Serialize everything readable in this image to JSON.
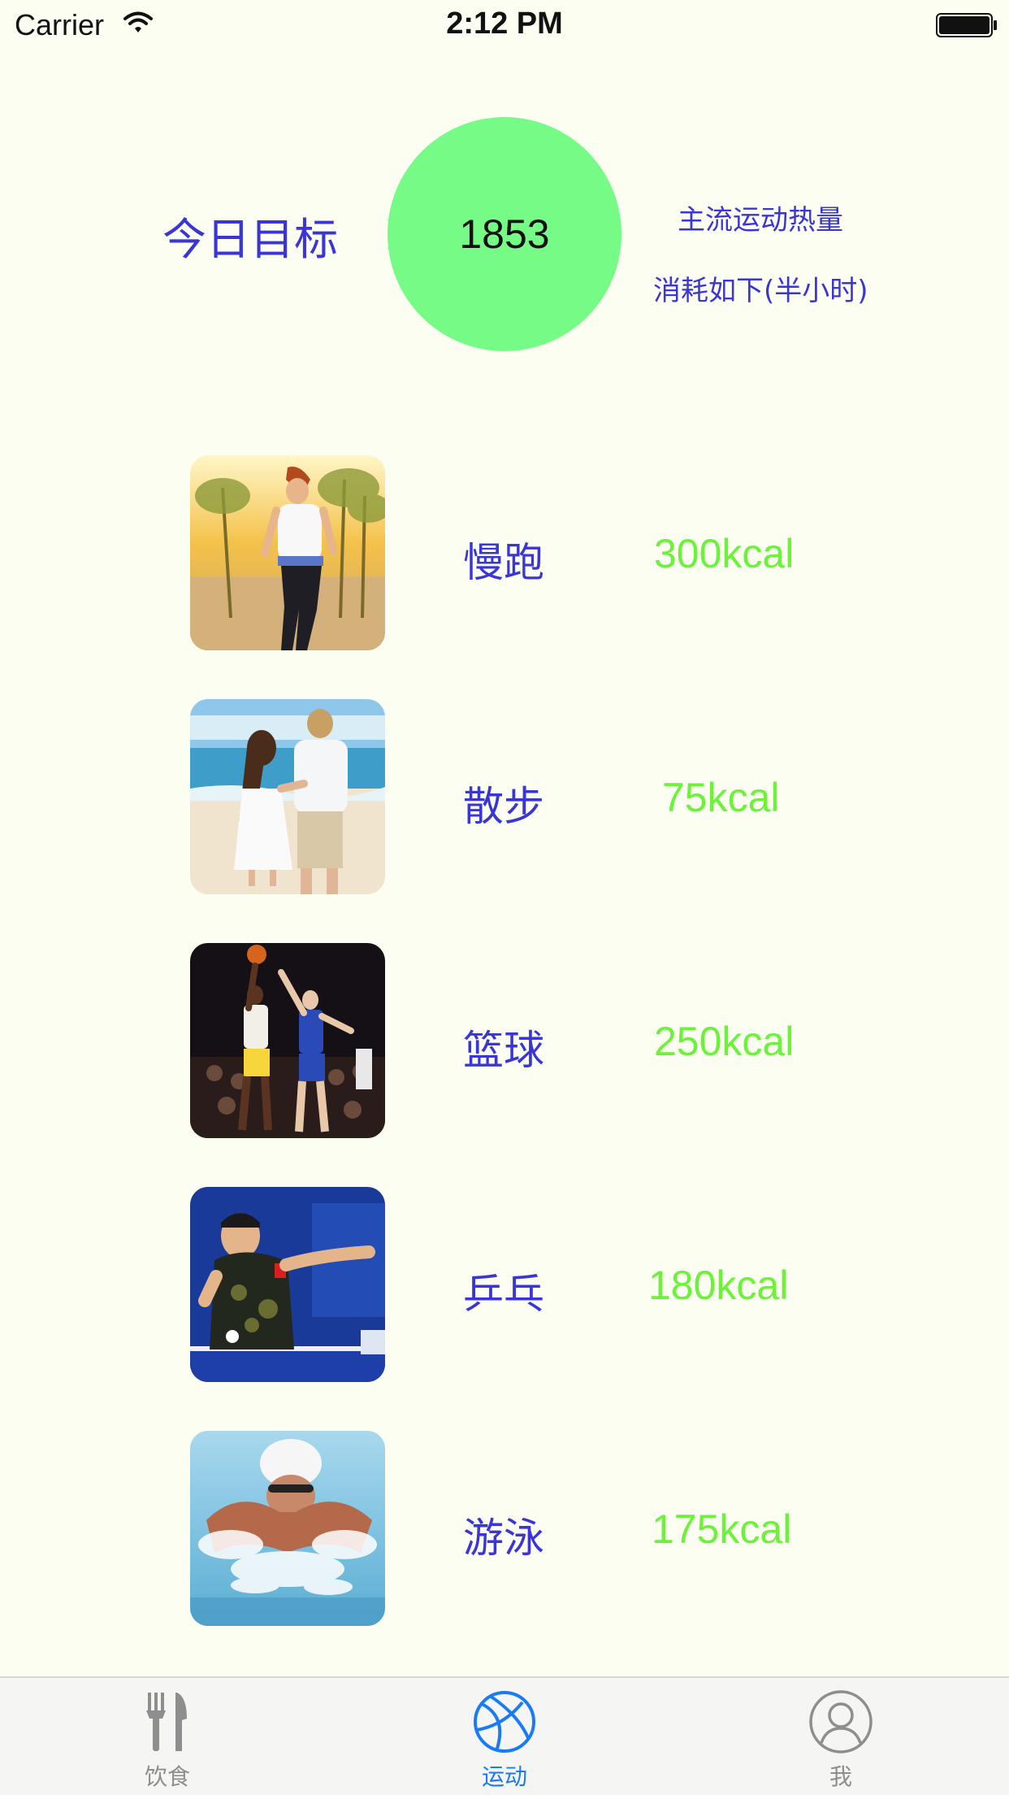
{
  "status_bar": {
    "carrier": "Carrier",
    "time": "2:12 PM"
  },
  "goal": {
    "label": "今日目标",
    "value": "1853",
    "circle_color": "#76fc86",
    "hint_line1": "主流运动热量",
    "hint_line2": "消耗如下(半小时)"
  },
  "exercises": [
    {
      "name": "慢跑",
      "kcal": "300kcal",
      "image": "running-photo"
    },
    {
      "name": "散步",
      "kcal": "75kcal",
      "image": "walking-photo"
    },
    {
      "name": "篮球",
      "kcal": "250kcal",
      "image": "basketball-photo"
    },
    {
      "name": "乒乓",
      "kcal": "180kcal",
      "image": "table-tennis-photo"
    },
    {
      "name": "游泳",
      "kcal": "175kcal",
      "image": "swimming-photo"
    }
  ],
  "tabs": [
    {
      "label": "饮食",
      "icon": "fork-knife-icon",
      "active": false
    },
    {
      "label": "运动",
      "icon": "basketball-icon",
      "active": true
    },
    {
      "label": "我",
      "icon": "profile-icon",
      "active": false
    }
  ],
  "colors": {
    "background": "#fbfef1",
    "label_blue": "#3a35d6",
    "kcal_green": "#6cf23a",
    "tab_active": "#1a7cf4",
    "tab_inactive": "#8e8e8e"
  }
}
